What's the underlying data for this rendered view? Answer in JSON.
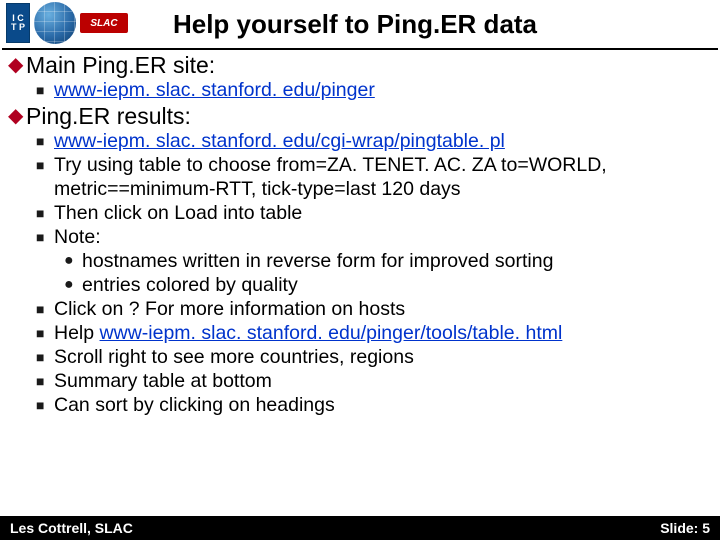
{
  "header": {
    "title": "Help yourself to Ping.ER data",
    "logos": {
      "ictp": "ICTP",
      "slac": "SLAC"
    }
  },
  "sections": {
    "main_site": {
      "heading": "Main Ping.ER site:",
      "link": "www-iepm. slac. stanford. edu/pinger"
    },
    "results": {
      "heading": "Ping.ER results:",
      "items": {
        "link1": "www-iepm. slac. stanford. edu/cgi-wrap/pingtable. pl",
        "try": "Try using table to choose from=ZA. TENET. AC. ZA to=WORLD, metric==minimum-RTT, tick-type=last 120 days",
        "then": "Then click on Load into table",
        "note": "Note:",
        "note_sub1": " hostnames written in reverse form for improved sorting",
        "note_sub2": "entries colored by quality",
        "click_q": "Click on ? For more information on hosts",
        "help_prefix": "Help ",
        "help_link": "www-iepm. slac. stanford. edu/pinger/tools/table. html",
        "scroll": "Scroll right to see more countries, regions",
        "summary": "Summary table at bottom",
        "sort": "Can sort by clicking on headings"
      }
    }
  },
  "footer": {
    "author": "Les Cottrell, SLAC",
    "slide": "Slide: 5"
  }
}
